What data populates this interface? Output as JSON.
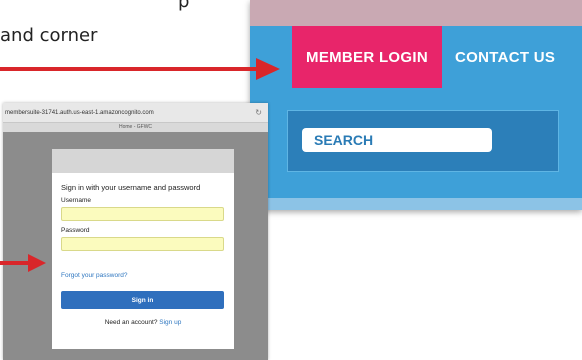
{
  "caption": {
    "line1": "p",
    "line2": "and corner"
  },
  "site_header": {
    "nav": {
      "member_login": "MEMBER LOGIN",
      "contact_us": "CONTACT US"
    },
    "search": {
      "label": "SEARCH"
    },
    "colors": {
      "header_blue": "#3ea0d8",
      "member_pink": "#e8256a",
      "search_band": "#2c7fb9"
    }
  },
  "login_popup": {
    "browser": {
      "url": "membersuite-31741.auth.us-east-1.amazoncognito.com",
      "tab_title": "Home - GFWC",
      "reload_icon": "reload-icon"
    },
    "form": {
      "title": "Sign in with your username and password",
      "username_label": "Username",
      "username_value": "",
      "password_label": "Password",
      "password_value": "",
      "forgot_link": "Forgot your password?",
      "sign_in_button": "Sign in",
      "need_account": "Need an account?",
      "sign_up_link": "Sign up"
    },
    "colors": {
      "button_blue": "#2f6fbd",
      "field_yellow": "#fbfbbe"
    }
  },
  "annotations": {
    "arrow_color": "#d9262a"
  }
}
